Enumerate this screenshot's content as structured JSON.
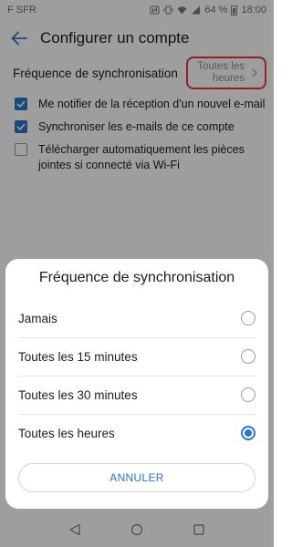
{
  "status_bar": {
    "carrier": "F SFR",
    "battery": "64 %",
    "time": "18:00"
  },
  "header": {
    "title": "Configurer un compte"
  },
  "settings": {
    "frequency_label": "Fréquence de synchronisation",
    "frequency_value": "Toutes les heures",
    "checkboxes": [
      {
        "label": "Me notifier de la réception d'un nouvel e-mail",
        "checked": true
      },
      {
        "label": "Synchroniser les e-mails de ce compte",
        "checked": true
      },
      {
        "label": "Télécharger automatiquement les pièces jointes si connecté via Wi-Fi",
        "checked": false
      }
    ]
  },
  "dialog": {
    "title": "Fréquence de synchronisation",
    "options": [
      {
        "label": "Jamais",
        "selected": false
      },
      {
        "label": "Toutes les 15 minutes",
        "selected": false
      },
      {
        "label": "Toutes les 30 minutes",
        "selected": false
      },
      {
        "label": "Toutes les heures",
        "selected": true
      }
    ],
    "cancel_label": "ANNULER"
  },
  "colors": {
    "accent": "#2c74c8",
    "highlight": "#e23b3b"
  }
}
